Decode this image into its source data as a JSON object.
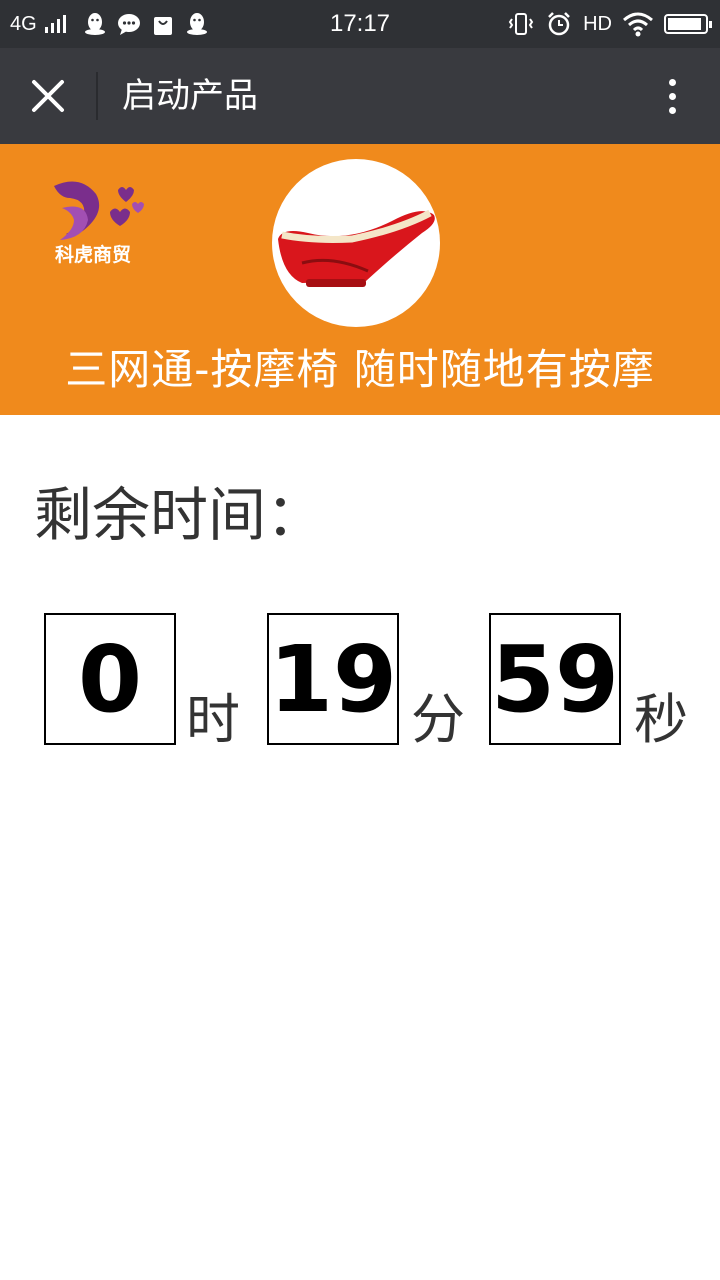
{
  "status_bar": {
    "network": "4G",
    "time": "17:17",
    "hd": "HD",
    "battery_level": 0.92,
    "icons": [
      "signal-icon",
      "qq-icon",
      "chat-icon",
      "shopping-bag-icon",
      "qq-icon",
      "vibrate-icon",
      "alarm-icon",
      "wifi-icon",
      "battery-icon"
    ]
  },
  "nav": {
    "title": "启动产品",
    "close_icon": "close-icon",
    "more_icon": "more-vertical-icon"
  },
  "banner": {
    "brand_name": "科虎商贸",
    "slogan": "三网通-按摩椅 随时随地有按摩",
    "background": "#f08a1c",
    "logo_color": "#7a2e8c",
    "product_color": "#d9161c"
  },
  "countdown": {
    "label": "剩余时间：",
    "hours": "0",
    "hours_unit": "时",
    "minutes": "19",
    "minutes_unit": "分",
    "seconds": "59",
    "seconds_unit": "秒"
  }
}
